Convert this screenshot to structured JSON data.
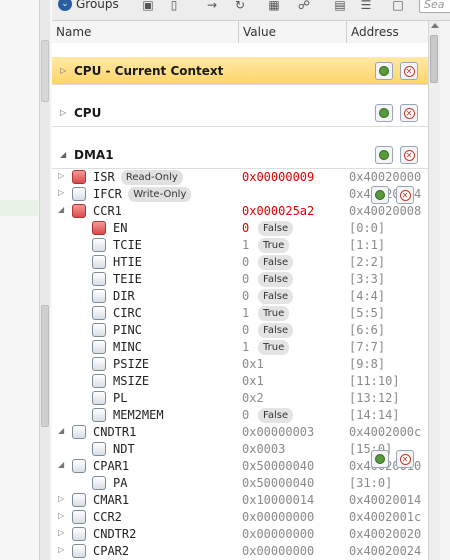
{
  "toolbar": {
    "groups_label": "Groups",
    "search_placeholder": "Sea"
  },
  "columns": [
    "Name",
    "Value",
    "Address"
  ],
  "groups": [
    {
      "name": "CPU - Current Context",
      "highlighted": true
    },
    {
      "name": "CPU",
      "highlighted": false
    },
    {
      "name": "DMA1",
      "highlighted": false
    }
  ],
  "registers": [
    {
      "name": "ISR",
      "badge": "Read-Only",
      "value": "0x00000009",
      "address": "0x40020000",
      "indent": 0,
      "checked": true,
      "expand": "right",
      "value_red": true
    },
    {
      "name": "IFCR",
      "badge": "Write-Only",
      "value": "",
      "address": "0x40020004",
      "indent": 0,
      "checked": false,
      "expand": "right",
      "value_red": false
    },
    {
      "name": "CCR1",
      "badge": "",
      "value": "0x000025a2",
      "address": "0x40020008",
      "indent": 0,
      "checked": true,
      "expand": "down",
      "value_red": true
    },
    {
      "name": "EN",
      "badge": "",
      "value": "0",
      "value_badge": "False",
      "address": "[0:0]",
      "indent": 1,
      "checked": true,
      "expand": "",
      "value_red": true
    },
    {
      "name": "TCIE",
      "badge": "",
      "value": "1",
      "value_badge": "True",
      "address": "[1:1]",
      "indent": 1,
      "checked": false,
      "expand": "",
      "value_red": false
    },
    {
      "name": "HTIE",
      "badge": "",
      "value": "0",
      "value_badge": "False",
      "address": "[2:2]",
      "indent": 1,
      "checked": false,
      "expand": "",
      "value_red": false
    },
    {
      "name": "TEIE",
      "badge": "",
      "value": "0",
      "value_badge": "False",
      "address": "[3:3]",
      "indent": 1,
      "checked": false,
      "expand": "",
      "value_red": false
    },
    {
      "name": "DIR",
      "badge": "",
      "value": "0",
      "value_badge": "False",
      "address": "[4:4]",
      "indent": 1,
      "checked": false,
      "expand": "",
      "value_red": false
    },
    {
      "name": "CIRC",
      "badge": "",
      "value": "1",
      "value_badge": "True",
      "address": "[5:5]",
      "indent": 1,
      "checked": false,
      "expand": "",
      "value_red": false
    },
    {
      "name": "PINC",
      "badge": "",
      "value": "0",
      "value_badge": "False",
      "address": "[6:6]",
      "indent": 1,
      "checked": false,
      "expand": "",
      "value_red": false
    },
    {
      "name": "MINC",
      "badge": "",
      "value": "1",
      "value_badge": "True",
      "address": "[7:7]",
      "indent": 1,
      "checked": false,
      "expand": "",
      "value_red": false
    },
    {
      "name": "PSIZE",
      "badge": "",
      "value": "0x1",
      "address": "[9:8]",
      "indent": 1,
      "checked": false,
      "expand": "",
      "value_red": false
    },
    {
      "name": "MSIZE",
      "badge": "",
      "value": "0x1",
      "address": "[11:10]",
      "indent": 1,
      "checked": false,
      "expand": "",
      "value_red": false
    },
    {
      "name": "PL",
      "badge": "",
      "value": "0x2",
      "address": "[13:12]",
      "indent": 1,
      "checked": false,
      "expand": "",
      "value_red": false
    },
    {
      "name": "MEM2MEM",
      "badge": "",
      "value": "0",
      "value_badge": "False",
      "address": "[14:14]",
      "indent": 1,
      "checked": false,
      "expand": "",
      "value_red": false
    },
    {
      "name": "CNDTR1",
      "badge": "",
      "value": "0x00000003",
      "address": "0x4002000c",
      "indent": 0,
      "checked": false,
      "expand": "down",
      "value_red": false
    },
    {
      "name": "NDT",
      "badge": "",
      "value": "0x0003",
      "address": "[15:0]",
      "indent": 1,
      "checked": false,
      "expand": "",
      "value_red": false
    },
    {
      "name": "CPAR1",
      "badge": "",
      "value": "0x50000040",
      "address": "0x40020010",
      "indent": 0,
      "checked": false,
      "expand": "down",
      "value_red": false
    },
    {
      "name": "PA",
      "badge": "",
      "value": "0x50000040",
      "address": "[31:0]",
      "indent": 1,
      "checked": false,
      "expand": "",
      "value_red": false
    },
    {
      "name": "CMAR1",
      "badge": "",
      "value": "0x10000014",
      "address": "0x40020014",
      "indent": 0,
      "checked": false,
      "expand": "right",
      "value_red": false
    },
    {
      "name": "CCR2",
      "badge": "",
      "value": "0x00000000",
      "address": "0x4002001c",
      "indent": 0,
      "checked": false,
      "expand": "right",
      "value_red": false
    },
    {
      "name": "CNDTR2",
      "badge": "",
      "value": "0x00000000",
      "address": "0x40020020",
      "indent": 0,
      "checked": false,
      "expand": "right",
      "value_red": false
    },
    {
      "name": "CPAR2",
      "badge": "",
      "value": "0x00000000",
      "address": "0x40020024",
      "indent": 0,
      "checked": false,
      "expand": "right",
      "value_red": false
    }
  ]
}
